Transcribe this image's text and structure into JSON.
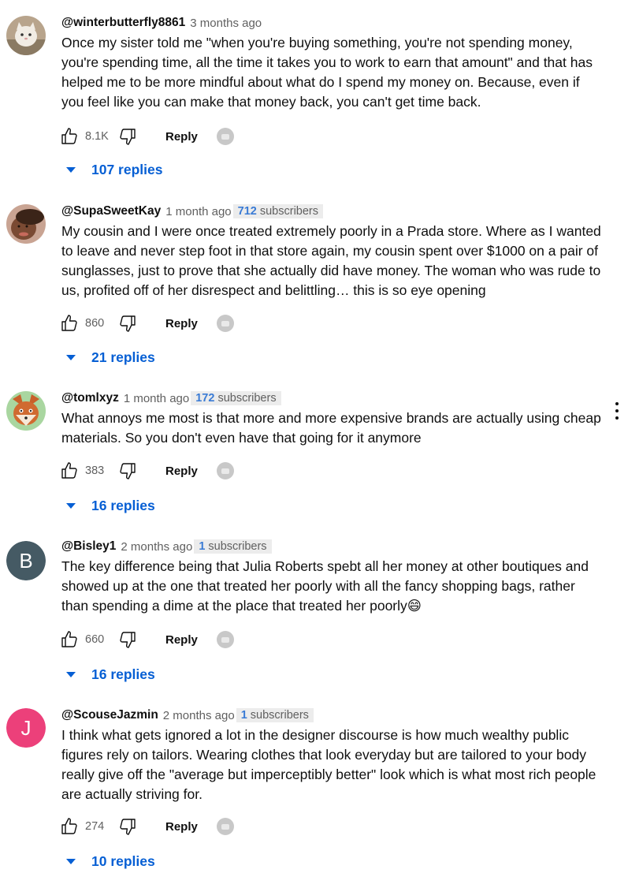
{
  "comments": [
    {
      "handle": "@winterbutterfly8861",
      "time": "3 months ago",
      "subs_num": "",
      "subs_label": "",
      "text": "Once my sister told me \"when you're buying something, you're not spending money, you're spending time, all the time it takes you to work to earn that amount\" and that has helped me to be more mindful about what do I spend my money on. Because, even if you feel like you can make that money back, you can't get time back.",
      "likes": "8.1K",
      "reply_label": "Reply",
      "replies": "107 replies",
      "avatar": "cat-photo-avatar"
    },
    {
      "handle": "@SupaSweetKay",
      "time": "1 month ago",
      "subs_num": "712",
      "subs_label": "subscribers",
      "text": "My cousin and I were once treated extremely poorly in a Prada store. Where as I wanted to leave and never step foot in that store again, my cousin spent over $1000 on a pair of sunglasses, just to prove that she actually did have money. The woman who was rude to us, profited off of her disrespect and belittling… this is so eye opening",
      "likes": "860",
      "reply_label": "Reply",
      "replies": "21 replies",
      "avatar": "person-photo-avatar"
    },
    {
      "handle": "@tomlxyz",
      "time": "1 month ago",
      "subs_num": "172",
      "subs_label": "subscribers",
      "text": "What annoys me most is that more and more expensive brands are actually using cheap materials. So you don't even have that going for it anymore",
      "likes": "383",
      "reply_label": "Reply",
      "replies": "16 replies",
      "avatar": "fox-avatar"
    },
    {
      "handle": "@Bisley1",
      "time": "2 months ago",
      "subs_num": "1",
      "subs_label": "subscribers",
      "text": "The key difference being that Julia Roberts spebt all her money at other boutiques and showed up at the one that treated her poorly with all the fancy shopping bags, rather than spending a dime at the place that treated her poorly😄",
      "likes": "660",
      "reply_label": "Reply",
      "replies": "16 replies",
      "avatar_letter": "B",
      "avatar_color": "#455a64"
    },
    {
      "handle": "@ScouseJazmin",
      "time": "2 months ago",
      "subs_num": "1",
      "subs_label": "subscribers",
      "text": "I think what gets ignored a lot in the designer discourse is how much wealthy public figures rely on tailors. Wearing clothes that look everyday but are tailored to your body really give off the \"average but imperceptibly better\" look which is what most rich people are actually striving for.",
      "likes": "274",
      "reply_label": "Reply",
      "replies": "10 replies",
      "avatar_letter": "J",
      "avatar_color": "#ec407a"
    }
  ],
  "colors": {
    "link_blue": "#065fd4",
    "muted": "#606060",
    "subs_number": "#3a7bd5"
  },
  "icons": [
    "thumbs-up-icon",
    "thumbs-down-icon",
    "creator-heart-icon",
    "caret-down-icon",
    "more-vert-icon"
  ]
}
